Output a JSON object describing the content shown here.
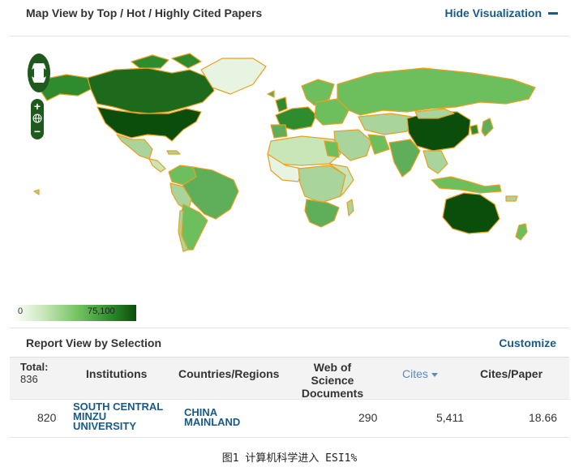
{
  "map_header": {
    "title": "Map View by Top / Hot / Highly Cited Papers",
    "hide_label": "Hide Visualization"
  },
  "map": {
    "zoom_in": "+",
    "zoom_out": "−",
    "legend_min": "0",
    "legend_max": "75,100",
    "colors": {
      "land_border": "#e8a020",
      "darkest": "#0b4d0b",
      "dark": "#2e8b2e",
      "medium": "#5fae5a",
      "light": "#a9d59c",
      "lightest": "#e8f4e2"
    }
  },
  "report": {
    "title": "Report View by Selection",
    "customize": "Customize"
  },
  "table": {
    "headers": {
      "total_label": "Total:",
      "total_value": "836",
      "institutions": "Institutions",
      "countries": "Countries/Regions",
      "wos_line1": "Web of Science",
      "wos_line2": "Documents",
      "cites": "Cites",
      "cites_per_paper": "Cites/Paper"
    },
    "rows": [
      {
        "rank": "820",
        "institution_lines": [
          "SOUTH CENTRAL",
          "MINZU",
          "UNIVERSITY"
        ],
        "country_lines": [
          "CHINA",
          "MAINLAND"
        ],
        "wos_documents": "290",
        "cites": "5,411",
        "cites_per_paper": "18.66"
      }
    ]
  },
  "caption": "图1 计算机科学进入 ESI1%"
}
